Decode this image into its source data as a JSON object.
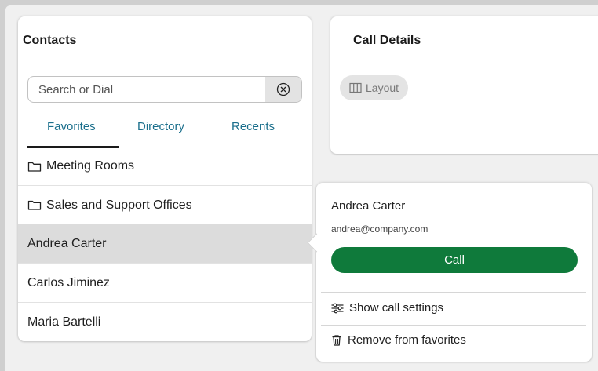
{
  "contacts": {
    "title": "Contacts",
    "search": {
      "placeholder": "Search or Dial",
      "value": ""
    },
    "tabs": [
      {
        "label": "Favorites",
        "active": true
      },
      {
        "label": "Directory",
        "active": false
      },
      {
        "label": "Recents",
        "active": false
      }
    ],
    "items": [
      {
        "label": "Meeting Rooms",
        "type": "folder",
        "icon": "folder-icon"
      },
      {
        "label": "Sales and Support Offices",
        "type": "folder",
        "icon": "folder-icon"
      },
      {
        "label": "Andrea Carter",
        "type": "contact",
        "selected": true
      },
      {
        "label": "Carlos Jiminez",
        "type": "contact"
      },
      {
        "label": "Maria Bartelli",
        "type": "contact"
      }
    ]
  },
  "call_details": {
    "title": "Call Details",
    "layout_label": "Layout"
  },
  "popover": {
    "name": "Andrea Carter",
    "email": "andrea@company.com",
    "call_label": "Call",
    "show_settings_label": "Show call settings",
    "remove_label": "Remove from favorites"
  },
  "colors": {
    "accent_link": "#1b6f8c",
    "call_green": "#0f7a3b",
    "selected_row": "#dcdcdc"
  }
}
